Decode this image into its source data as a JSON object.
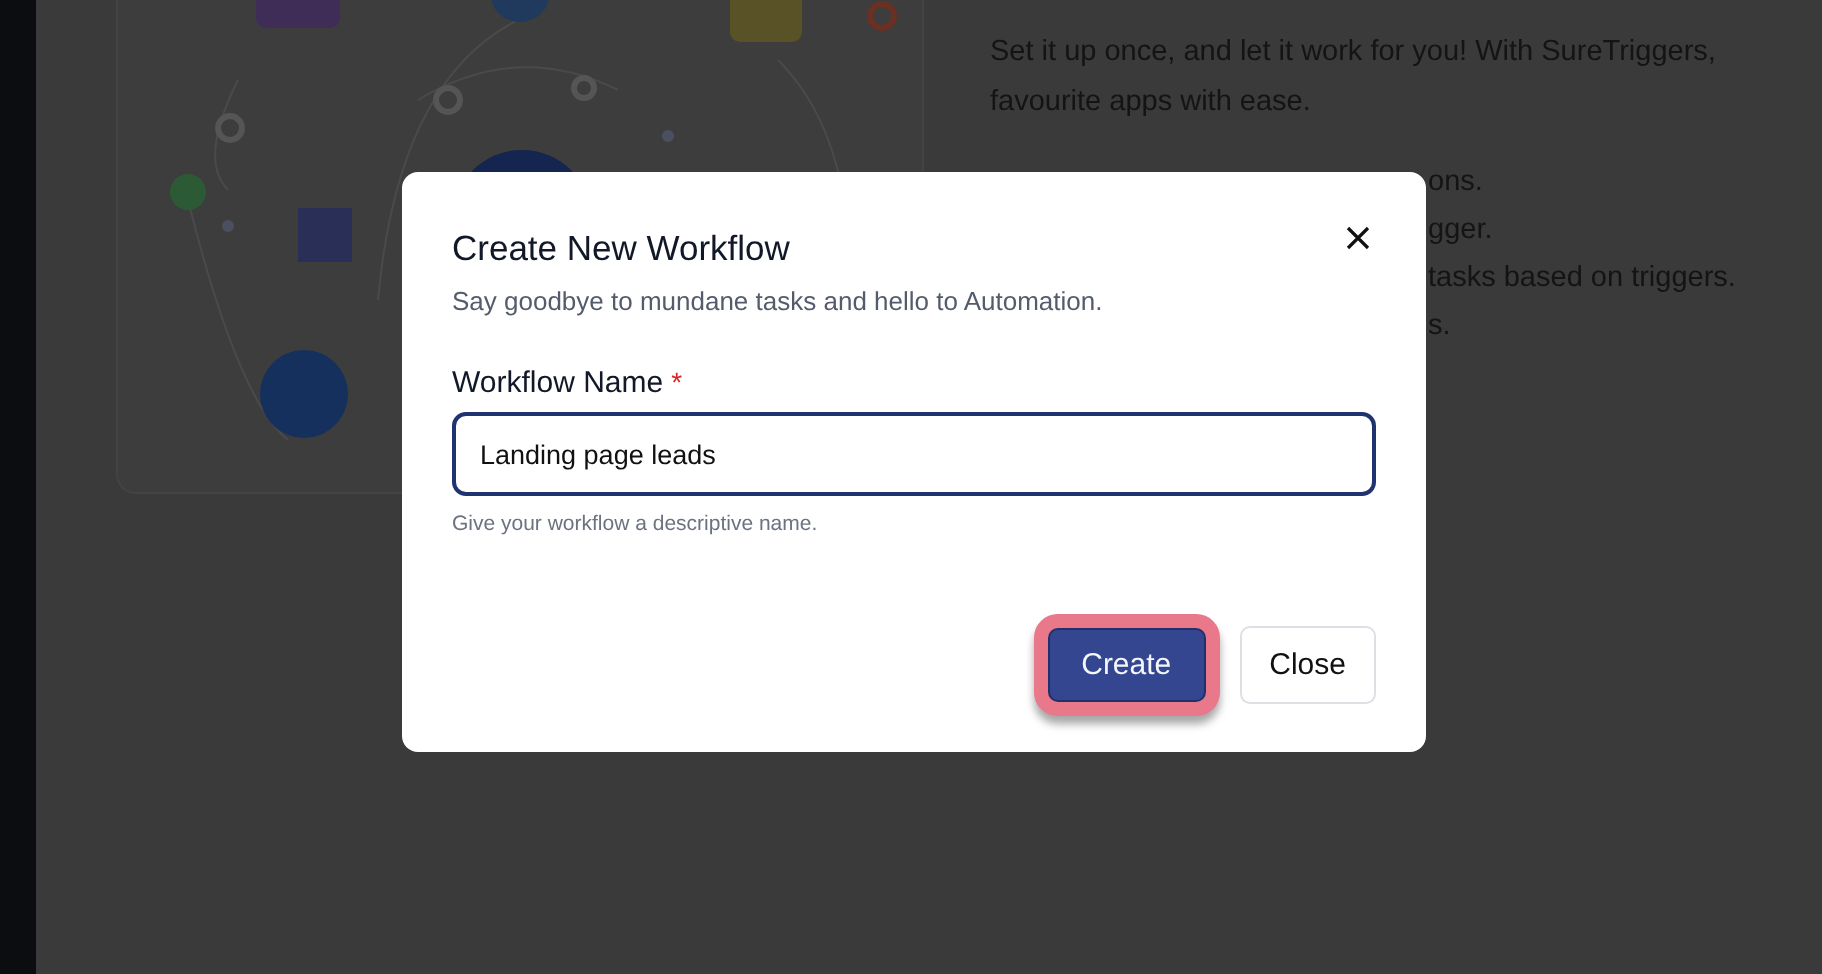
{
  "background": {
    "intro_lines": [
      "Set it up once, and let it work for you! With SureTriggers,",
      "favourite apps with ease."
    ],
    "list_fragments": [
      "ons.",
      "gger.",
      "tasks based on triggers.",
      "s."
    ]
  },
  "dialog": {
    "title": "Create New Workflow",
    "subtitle": "Say goodbye to mundane tasks and hello to Automation.",
    "field": {
      "label": "Workflow Name",
      "required_mark": "*",
      "value": "Landing page leads",
      "help": "Give your workflow a descriptive name."
    },
    "buttons": [
      {
        "label": "Create",
        "kind": "primary",
        "highlighted": true
      },
      {
        "label": "Close",
        "kind": "secondary",
        "highlighted": false
      }
    ]
  }
}
